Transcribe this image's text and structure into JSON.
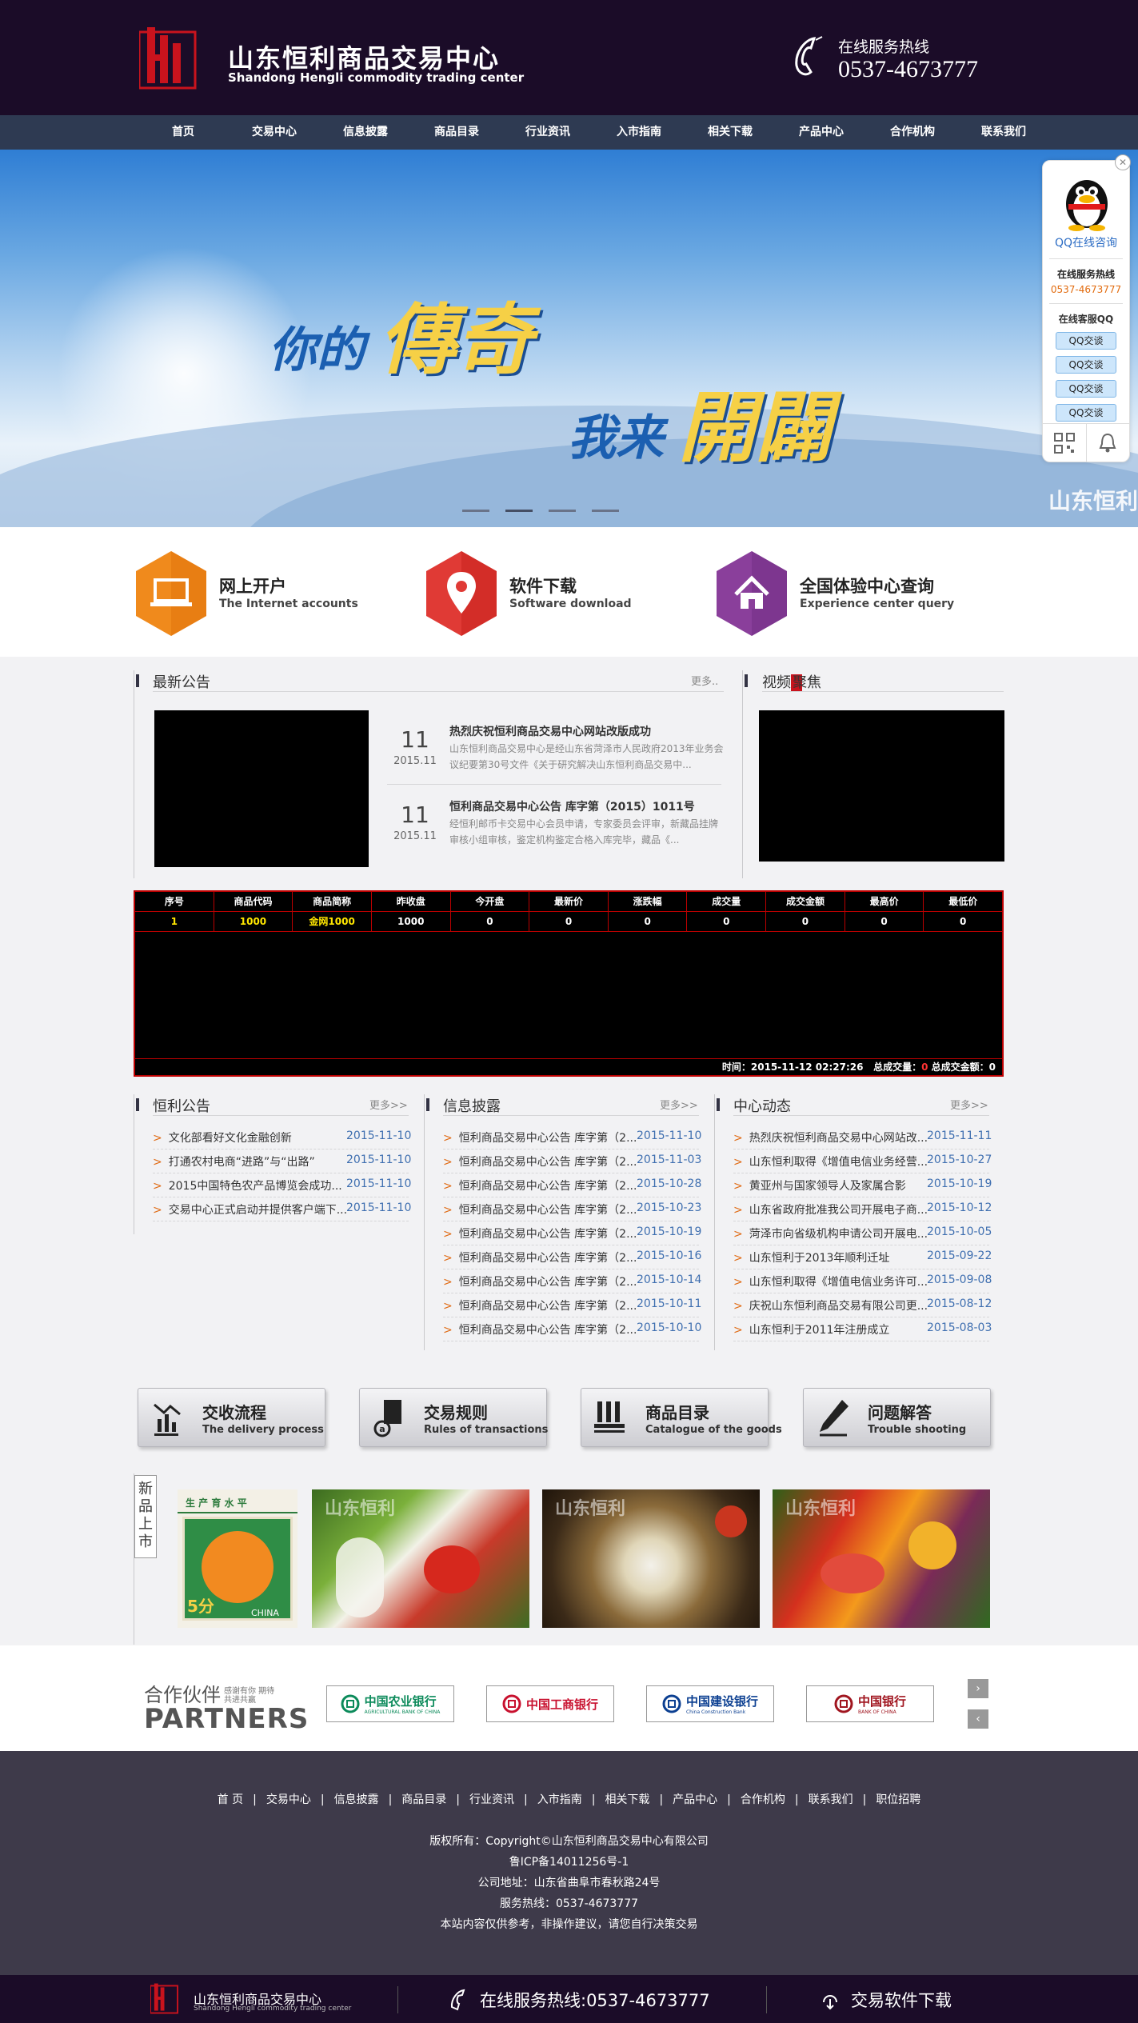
{
  "header": {
    "title": "山东恒利商品交易中心",
    "subtitle": "Shandong Hengli commodity trading center",
    "hotline_label": "在线服务热线",
    "hotline_number": "0537-4673777"
  },
  "nav": [
    "首页",
    "交易中心",
    "信息披露",
    "商品目录",
    "行业资讯",
    "入市指南",
    "相关下载",
    "产品中心",
    "合作机构",
    "联系我们"
  ],
  "banner": {
    "line1_small": "你的",
    "line1_big": "傳奇",
    "line2_small": "我来",
    "line2_big": "開闢",
    "tag": "山东恒利"
  },
  "float_panel": {
    "consult": "QQ在线咨询",
    "hotline_label": "在线服务热线",
    "hotline_number": "0537-4673777",
    "service_label": "在线客服QQ",
    "qq_buttons": [
      "QQ交谈",
      "QQ交谈",
      "QQ交谈",
      "QQ交谈"
    ]
  },
  "quick_links": [
    {
      "title": "网上开户",
      "sub": "The Internet accounts",
      "color": "#f08a1c",
      "icon": "laptop-icon"
    },
    {
      "title": "软件下载",
      "sub": "Software download",
      "color": "#e03a35",
      "icon": "location-pin-icon"
    },
    {
      "title": "全国体验中心查询",
      "sub": "Experience center query",
      "color": "#8a3f9b",
      "icon": "home-icon"
    }
  ],
  "notice": {
    "title": "最新公告",
    "more": "更多..",
    "items": [
      {
        "day": "11",
        "ym": "2015.11",
        "title": "热烈庆祝恒利商品交易中心网站改版成功",
        "desc": "山东恒利商品交易中心是经山东省菏泽市人民政府2013年业务会议纪要第30号文件《关于研究解决山东恒利商品交易中..."
      },
      {
        "day": "11",
        "ym": "2015.11",
        "title": "恒利商品交易中心公告 库字第（2015）1011号",
        "desc": "经恒利邮币卡交易中心会员申请，专家委员会评审，新藏品挂牌审核小组审核，鉴定机构鉴定合格入库完毕，藏品《..."
      }
    ]
  },
  "video": {
    "title_a": "视频",
    "title_b": "聚焦"
  },
  "quotes": {
    "headers": [
      "序号",
      "商品代码",
      "商品简称",
      "昨收盘",
      "今开盘",
      "最新价",
      "涨跌幅",
      "成交量",
      "成交金额",
      "最高价",
      "最低价"
    ],
    "rows": [
      [
        "1",
        "1000",
        "金网1000",
        "1000",
        "0",
        "0",
        "0",
        "0",
        "0",
        "0",
        "0"
      ]
    ],
    "time_label": "时间：",
    "time_value": "2015-11-12 02:27:26",
    "vol_label": "总成交量：",
    "vol_value": "0",
    "amount_label": "总成交金额：",
    "amount_value": "0"
  },
  "lists": [
    {
      "title": "恒利公告",
      "more": "更多>>",
      "items": [
        {
          "text": "文化部看好文化金融创新",
          "date": "2015-11-10"
        },
        {
          "text": "打通农村电商“进路”与“出路”",
          "date": "2015-11-10"
        },
        {
          "text": "2015中国特色农产品博览会成功...",
          "date": "2015-11-10"
        },
        {
          "text": "交易中心正式启动并提供客户端下...",
          "date": "2015-11-10"
        }
      ]
    },
    {
      "title": "信息披露",
      "more": "更多>>",
      "items": [
        {
          "text": "恒利商品交易中心公告 库字第（2...",
          "date": "2015-11-10"
        },
        {
          "text": "恒利商品交易中心公告 库字第（2...",
          "date": "2015-11-03"
        },
        {
          "text": "恒利商品交易中心公告 库字第（2...",
          "date": "2015-10-28"
        },
        {
          "text": "恒利商品交易中心公告 库字第（2...",
          "date": "2015-10-23"
        },
        {
          "text": "恒利商品交易中心公告 库字第（2...",
          "date": "2015-10-19"
        },
        {
          "text": "恒利商品交易中心公告 库字第（2...",
          "date": "2015-10-16"
        },
        {
          "text": "恒利商品交易中心公告 库字第（2...",
          "date": "2015-10-14"
        },
        {
          "text": "恒利商品交易中心公告 库字第（2...",
          "date": "2015-10-11"
        },
        {
          "text": "恒利商品交易中心公告 库字第（2...",
          "date": "2015-10-10"
        }
      ]
    },
    {
      "title": "中心动态",
      "more": "更多>>",
      "items": [
        {
          "text": "热烈庆祝恒利商品交易中心网站改...",
          "date": "2015-11-11"
        },
        {
          "text": "山东恒利取得《增值电信业务经营...",
          "date": "2015-10-27"
        },
        {
          "text": "黄亚州与国家领导人及家属合影",
          "date": "2015-10-19"
        },
        {
          "text": "山东省政府批准我公司开展电子商...",
          "date": "2015-10-12"
        },
        {
          "text": "菏泽市向省级机构申请公司开展电...",
          "date": "2015-10-05"
        },
        {
          "text": "山东恒利于2013年顺利迁址",
          "date": "2015-09-22"
        },
        {
          "text": "山东恒利取得《增值电信业务许可...",
          "date": "2015-09-08"
        },
        {
          "text": "庆祝山东恒利商品交易有限公司更...",
          "date": "2015-08-12"
        },
        {
          "text": "山东恒利于2011年注册成立",
          "date": "2015-08-03"
        }
      ]
    }
  ],
  "guide_buttons": [
    {
      "title": "交收流程",
      "sub": "The delivery process",
      "icon": "chart-icon"
    },
    {
      "title": "交易规则",
      "sub": "Rules of transactions",
      "icon": "rules-icon"
    },
    {
      "title": "商品目录",
      "sub": "Catalogue of the goods",
      "icon": "catalogue-icon"
    },
    {
      "title": "问题解答",
      "sub": "Trouble shooting",
      "icon": "pen-icon"
    }
  ],
  "new_products": {
    "label": "新品上市",
    "stamp_text": "CHINA",
    "stamp_value": "5分",
    "stamp_top": "生  产  育  水  平",
    "watermark": "山东恒利"
  },
  "partners": {
    "title_cn": "合作伙伴",
    "tagline": "感谢有你 期待共进共赢",
    "title_en": "PARTNERS",
    "banks": [
      {
        "name": "中国农业银行",
        "en": "AGRICULTURAL BANK OF CHINA",
        "color": "#0b8a5a"
      },
      {
        "name": "中国工商银行",
        "en": "",
        "color": "#c8102e"
      },
      {
        "name": "中国建设银行",
        "en": "China Construction Bank",
        "color": "#0b3f91"
      },
      {
        "name": "中国银行",
        "en": "BANK OF CHINA",
        "color": "#a0151f"
      }
    ],
    "next": "›",
    "prev": "‹"
  },
  "footer": {
    "nav": [
      "首 页",
      "交易中心",
      "信息披露",
      "商品目录",
      "行业资讯",
      "入市指南",
      "相关下载",
      "产品中心",
      "合作机构",
      "联系我们",
      "职位招聘"
    ],
    "copyright": "版权所有：Copyright©山东恒利商品交易中心有限公司",
    "icp": "鲁ICP备14011256号-1",
    "address": "公司地址：山东省曲阜市春秋路24号",
    "hotline": "服务热线：0537-4673777",
    "disclaimer": "本站内容仅供参考，非操作建议，请您自行决策交易"
  },
  "bottom_bar": {
    "name": "山东恒利商品交易中心",
    "sub": "Shandong Hengli commodity trading center",
    "hotline": "在线服务热线:0537-4673777",
    "download": "交易软件下载"
  }
}
